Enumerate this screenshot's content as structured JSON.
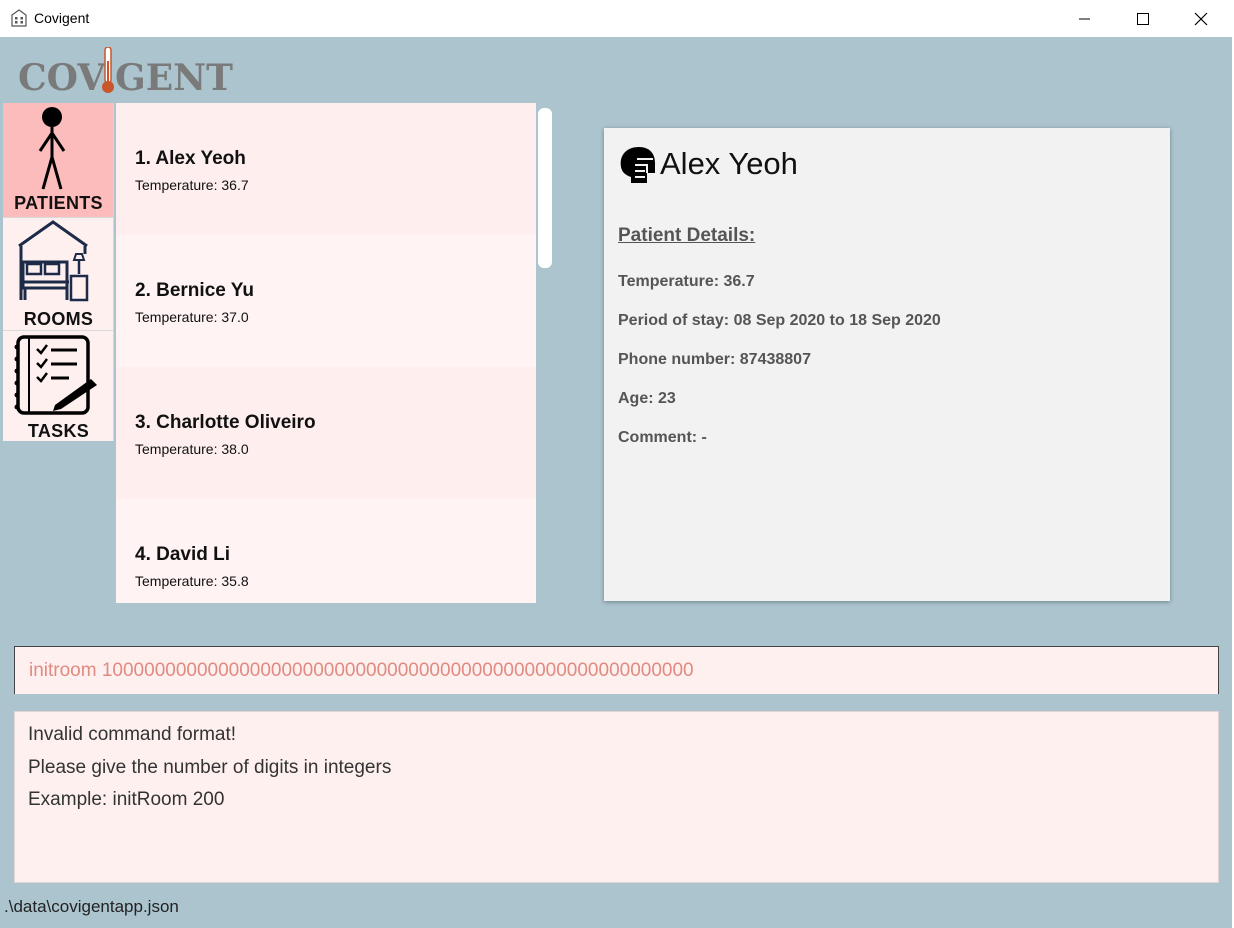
{
  "window": {
    "title": "Covigent",
    "icon": "hotel-building-icon",
    "controls": [
      "minimize-icon",
      "maximize-icon",
      "close-icon"
    ]
  },
  "logo": {
    "text_left": "COV",
    "text_right": "GENT",
    "icon": "thermometer-icon",
    "accent_color": "#c9562c"
  },
  "nav": [
    {
      "label": "PATIENTS",
      "icon": "stick-figure-icon",
      "selected": true
    },
    {
      "label": "ROOMS",
      "icon": "bedroom-icon",
      "selected": false
    },
    {
      "label": "TASKS",
      "icon": "task-list-icon",
      "selected": false
    }
  ],
  "patients": [
    {
      "name": "1.  Alex Yeoh",
      "temperature": "Temperature: 36.7"
    },
    {
      "name": "2.  Bernice Yu",
      "temperature": "Temperature: 37.0"
    },
    {
      "name": "3.  Charlotte Oliveiro",
      "temperature": "Temperature: 38.0"
    },
    {
      "name": "4.  David Li",
      "temperature": "Temperature: 35.8"
    }
  ],
  "detail": {
    "icon": "patient-head-icon",
    "name": "Alex Yeoh",
    "heading": "Patient Details:",
    "temperature": "Temperature: 36.7",
    "period": "Period of stay: 08 Sep 2020 to 18 Sep 2020",
    "phone": "Phone number: 87438807",
    "age": "Age: 23",
    "comment": "Comment: -"
  },
  "command": {
    "value": "initroom 10000000000000000000000000000000000000000000000000000000"
  },
  "result": [
    "Invalid command format!",
    "Please give the number of digits in integers",
    "Example: initRoom 200"
  ],
  "status": {
    "file_path": ".\\data\\covigentapp.json"
  },
  "colors": {
    "background": "#abc4ce",
    "selected_nav": "#fdbcbc",
    "panel_pink": "#fff0f0",
    "command_text": "#e08a80"
  }
}
